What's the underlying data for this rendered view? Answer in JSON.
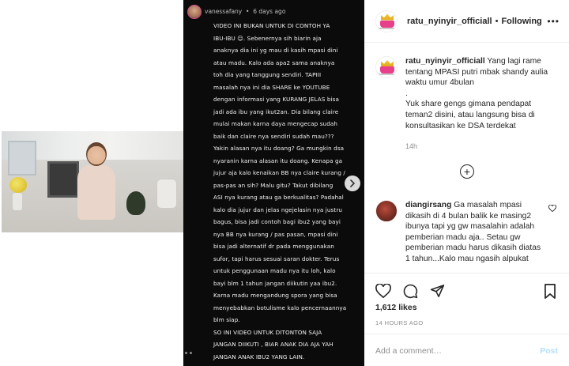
{
  "story": {
    "username": "vanessafany",
    "time": "6 days ago",
    "text": "VIDEO INI BUKAN UNTUK DI CONTOH YA\nIBU-IBU ☺. Sebenernya sih biarin aja\nanaknya dia ini yg mau di kasih mpasi dini\natau madu. Kalo ada apa2 sama anaknya\ntoh dia yang tanggung sendiri. TAPIII\nmasalah nya ini dia SHARE ke YOUTUBE\ndengan informasi yang KURANG JELAS bisa\njadi ada ibu yang ikut2an. Dia bilang claire\nmulai makan karna daya mengecap sudah\nbaik dan claire nya sendiri sudah mau???\nYakin alasan nya itu doang? Ga mungkin dsa\nnyaranin karna alasan itu doang. Kenapa ga\njujur aja kalo kenaikan BB nya claire kurang /\npas-pas an sih? Malu gitu? Takut dibilang\nASI nya kurang atau ga berkualitas? Padahal\nkalo dia jujur dan jelas ngejelasin nya justru\nbagus, bisa jadi contoh bagi ibu2 yang bayi\nnya BB nya kurang / pas pasan, mpasi dini\nbisa jadi alternatif dr pada menggunakan\nsufor, tapi harus sesuai saran dokter. Terus\nuntuk penggunaan madu nya itu loh, kalo\nbayi blm 1 tahun jangan diikutin yaa ibu2.\nKarna madu mengandung spora yang bisa\nmenyebabkan botulisme kalo pencernaannya\nblm siap.\nSO INI VIDEO UNTUK DITONTON SAJA\nJANGAN DIIKUTI , BIAR ANAK DIA AJA YAH\nJANGAN ANAK IBU2 YANG LAIN."
  },
  "header": {
    "username": "ratu_nyinyir_officiall",
    "separator": "•",
    "follow_status": "Following",
    "more": "•••"
  },
  "caption": {
    "username": "ratu_nyinyir_officiall",
    "text": " Yang lagi rame tentang MPASI putri mbak shandy aulia waktu umur 4bulan\n.\nYuk share gengs gimana pendapat teman2 disini, atau langsung bisa di konsultasikan ke DSA terdekat",
    "time": "14h"
  },
  "load_more": "+",
  "reply": {
    "username": "diangirsang",
    "text": " Ga masalah mpasi dikasih di 4 bulan balik ke masing2 ibunya tapi yg gw masalahin adalah pemberian madu aja.. Setau gw pemberian madu harus dikasih diatas 1 tahun...Kalo mau ngasih alpukat"
  },
  "actions": {
    "likes": "1,612 likes",
    "time_ago": "14 HOURS AGO",
    "comment_placeholder": "Add a comment…",
    "post_label": "Post"
  },
  "colors": {
    "text": "#262626",
    "muted": "#8e8e8e",
    "post_disabled": "#b2dffc",
    "story_bg": "#0b0b0b"
  }
}
